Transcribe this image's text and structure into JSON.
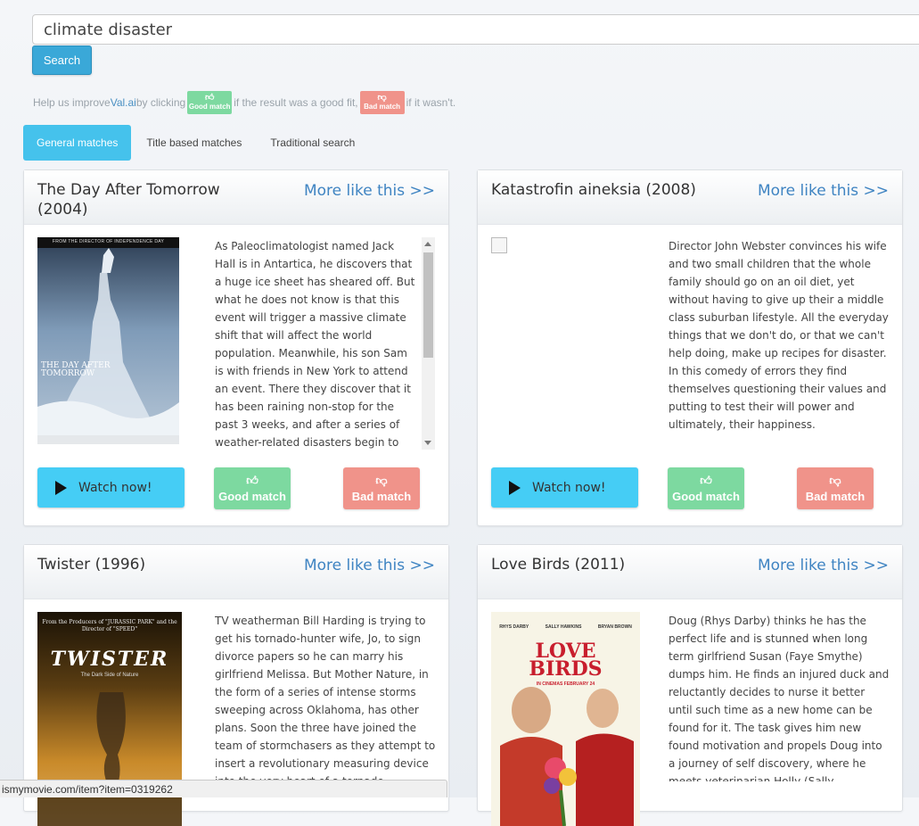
{
  "search": {
    "value": "climate disaster",
    "button_label": "Search"
  },
  "help": {
    "prefix": "Help us improve ",
    "brand": "Val.ai",
    "middle": " by clicking ",
    "good_badge": "Good match",
    "after_good": " if the result was a good fit, ",
    "bad_badge": "Bad match",
    "suffix": " if it wasn't."
  },
  "tabs": [
    {
      "label": "General matches",
      "active": true
    },
    {
      "label": "Title based matches",
      "active": false
    },
    {
      "label": "Traditional search",
      "active": false
    }
  ],
  "cards": [
    {
      "title": "The Day After Tomorrow (2004)",
      "more_label": "More like this >>",
      "description": "As Paleoclimatologist named Jack Hall is in Antartica, he discovers that a huge ice sheet has sheared off. But what he does not know is that this event will trigger a massive climate shift that will affect the world population. Meanwhile, his son Sam is with friends in New York to attend an event. There they discover that it has been raining non-stop for the past 3 weeks, and after a series of weather-related disasters begin to occur over the world, everybody realizes the world is entering another Ice Age.",
      "poster_tagline": "FROM THE DIRECTOR OF INDEPENDENCE DAY",
      "poster_title": "THE DAY AFTER TOMORROW",
      "watch_label": "Watch now!",
      "good_label": "Good match",
      "bad_label": "Bad match"
    },
    {
      "title": "Katastrofin aineksia (2008)",
      "more_label": "More like this >>",
      "description": "Director John Webster convinces his wife and two small children that the whole family should go on an oil diet, yet without having to give up their a middle class suburban lifestyle. All the everyday things that we don't do, or that we can't help doing, make up recipes for disaster. In this comedy of errors they find themselves questioning their values and putting to test their will power and ultimately, their happiness.",
      "watch_label": "Watch now!",
      "good_label": "Good match",
      "bad_label": "Bad match"
    },
    {
      "title": "Twister (1996)",
      "more_label": "More like this >>",
      "description": "TV weatherman Bill Harding is trying to get his tornado-hunter wife, Jo, to sign divorce papers so he can marry his girlfriend Melissa. But Mother Nature, in the form of a series of intense storms sweeping across Oklahoma, has other plans. Soon the three have joined the team of stormchasers as they attempt to insert a revolutionary measuring device into the very heart of a tornado.",
      "poster_tagline": "From the Producers of \"JURASSIC PARK\" and the Director of \"SPEED\"",
      "poster_title": "TWISTER",
      "poster_sub": "The Dark Side of Nature"
    },
    {
      "title": "Love Birds (2011)",
      "more_label": "More like this >>",
      "description": "Doug (Rhys Darby) thinks he has the perfect life and is stunned when long term girlfriend Susan (Faye Smythe) dumps him. He finds an injured duck and reluctantly decides to nurse it better until such time as a new home can be found for it. The task gives him new found motivation and propels Doug into a journey of self discovery, where he meets veterinarian Holly (Sally Hawkins). Will the duck ever fly again? And will Doug find his perfect life?",
      "poster_cast": [
        "RHYS DARBY",
        "SALLY HAWKINS",
        "BRYAN BROWN"
      ],
      "poster_title_1": "LOVE",
      "poster_title_2": "BIRDS",
      "poster_release": "IN CINEMAS FEBRUARY 24"
    }
  ],
  "status_url": "ismymovie.com/item?item=0319262",
  "colors": {
    "accent": "#45c2ec",
    "link": "#3f84c2",
    "good": "#7dd9a0",
    "bad": "#f0938a"
  }
}
